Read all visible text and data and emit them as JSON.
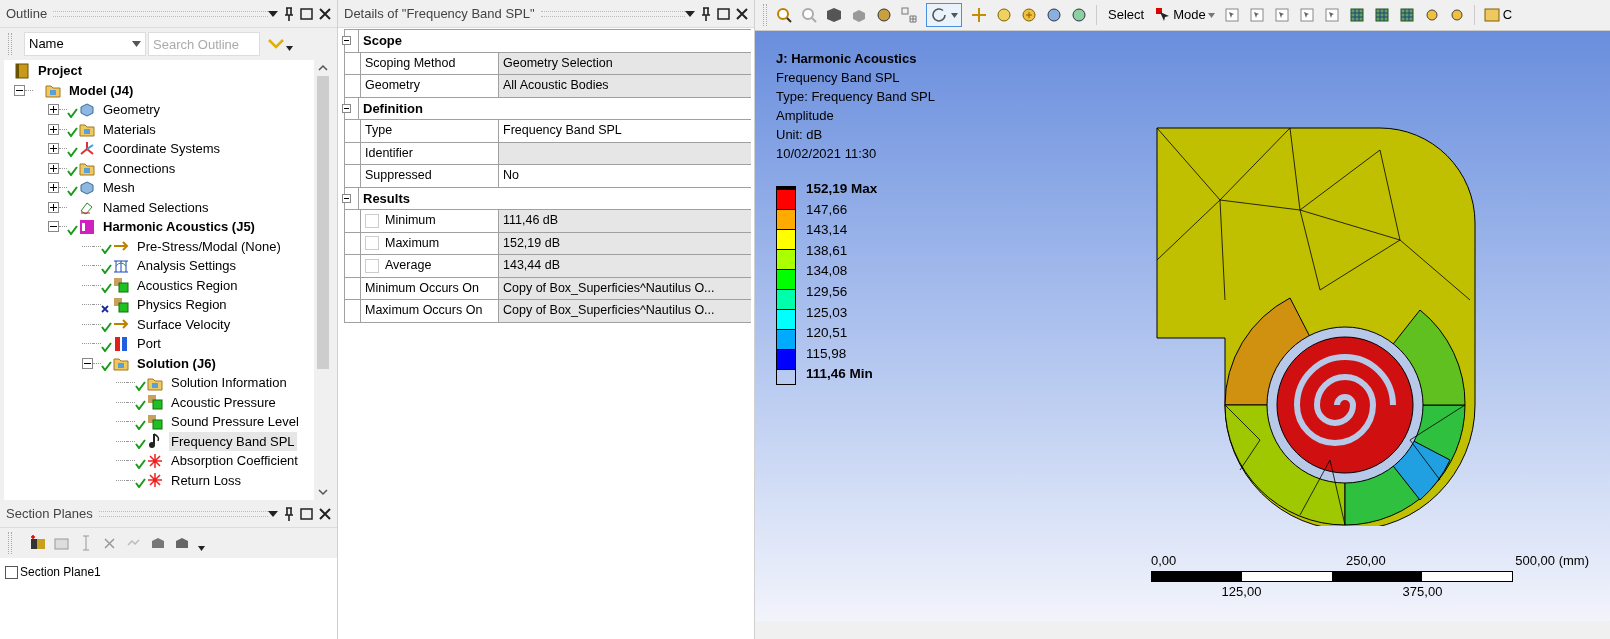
{
  "outline": {
    "title": "Outline",
    "column_dropdown": "Name",
    "search": {
      "placeholder": "Search Outline"
    },
    "tree": [
      {
        "label": "Project",
        "bold": true,
        "selected": false,
        "children": [
          {
            "label": "Model (J4)",
            "bold": true,
            "expanded": true,
            "selected": false,
            "children": [
              {
                "label": "Geometry",
                "valid": true,
                "expanded": false,
                "selected": false
              },
              {
                "label": "Materials",
                "valid": true,
                "expanded": false,
                "selected": false
              },
              {
                "label": "Coordinate Systems",
                "valid": true,
                "expanded": false,
                "selected": false
              },
              {
                "label": "Connections",
                "valid": true,
                "expanded": false,
                "selected": false
              },
              {
                "label": "Mesh",
                "valid": true,
                "expanded": false,
                "selected": false
              },
              {
                "label": "Named Selections",
                "expanded": false,
                "selected": false
              },
              {
                "label": "Harmonic Acoustics (J5)",
                "bold": true,
                "valid": true,
                "expanded": true,
                "selected": false,
                "children": [
                  {
                    "label": "Pre-Stress/Modal (None)",
                    "valid": true,
                    "selected": false
                  },
                  {
                    "label": "Analysis Settings",
                    "valid": true,
                    "selected": false
                  },
                  {
                    "label": "Acoustics Region",
                    "valid": true,
                    "selected": false
                  },
                  {
                    "label": "Physics Region",
                    "valid": false,
                    "selected": false
                  },
                  {
                    "label": "Surface Velocity",
                    "valid": true,
                    "selected": false
                  },
                  {
                    "label": "Port",
                    "valid": true,
                    "selected": false
                  },
                  {
                    "label": "Solution (J6)",
                    "bold": true,
                    "valid": true,
                    "expanded": true,
                    "selected": false,
                    "children": [
                      {
                        "label": "Solution Information",
                        "valid": true,
                        "selected": false
                      },
                      {
                        "label": "Acoustic Pressure",
                        "valid": true,
                        "selected": false
                      },
                      {
                        "label": "Sound Pressure Level",
                        "valid": true,
                        "selected": false
                      },
                      {
                        "label": "Frequency Band SPL",
                        "valid": true,
                        "selected": true
                      },
                      {
                        "label": "Absorption Coefficient",
                        "valid": true,
                        "selected": false
                      },
                      {
                        "label": "Return Loss",
                        "valid": true,
                        "selected": false
                      }
                    ]
                  }
                ]
              }
            ]
          }
        ]
      }
    ]
  },
  "section_planes": {
    "title": "Section Planes",
    "items": [
      {
        "label": "Section Plane1",
        "checked": false
      }
    ]
  },
  "details": {
    "title": "Details of \"Frequency Band SPL\"",
    "sections": [
      {
        "title": "Scope",
        "expanded": true,
        "rows": [
          {
            "kind": "plain",
            "label": "Scoping Method",
            "value": "Geometry Selection",
            "editable": false
          },
          {
            "kind": "plain",
            "label": "Geometry",
            "value": "All Acoustic Bodies",
            "editable": false
          }
        ]
      },
      {
        "title": "Definition",
        "expanded": true,
        "rows": [
          {
            "kind": "plain",
            "label": "Type",
            "value": "Frequency Band SPL",
            "editable": true
          },
          {
            "kind": "plain",
            "label": "Identifier",
            "value": "",
            "editable": false
          },
          {
            "kind": "plain",
            "label": "Suppressed",
            "value": "No",
            "editable": true
          }
        ]
      },
      {
        "title": "Results",
        "expanded": true,
        "rows": [
          {
            "kind": "checkbox",
            "checked": false,
            "label": "Minimum",
            "value": "111,46 dB",
            "editable": false
          },
          {
            "kind": "checkbox",
            "checked": false,
            "label": "Maximum",
            "value": "152,19 dB",
            "editable": false
          },
          {
            "kind": "checkbox",
            "checked": false,
            "label": "Average",
            "value": "143,44 dB",
            "editable": false
          },
          {
            "kind": "plain",
            "label": "Minimum Occurs On",
            "value": "Copy of Box_Superficies^Nautilus O...",
            "editable": false
          },
          {
            "kind": "plain",
            "label": "Maximum Occurs On",
            "value": "Copy of Box_Superficies^Nautilus O...",
            "editable": false
          }
        ]
      }
    ]
  },
  "viewport": {
    "toolbar": {
      "select_label": "Select",
      "mode_label": "Mode",
      "cut_label": "C"
    },
    "annotation": {
      "title": "J: Harmonic Acoustics",
      "lines": [
        "Frequency Band SPL",
        "Type: Frequency Band SPL",
        "Amplitude",
        "Unit: dB",
        "10/02/2021 11:30"
      ]
    },
    "legend": {
      "bands": [
        {
          "color": "#ff0000"
        },
        {
          "color": "#ffaa00"
        },
        {
          "color": "#ffff00"
        },
        {
          "color": "#aaff00"
        },
        {
          "color": "#00ff00"
        },
        {
          "color": "#00ffaa"
        },
        {
          "color": "#00ffff"
        },
        {
          "color": "#00aaff"
        },
        {
          "color": "#0000ff"
        }
      ],
      "labels": [
        {
          "text": "152,19 Max",
          "kind": "extreme"
        },
        {
          "text": "147,66",
          "kind": "tick"
        },
        {
          "text": "143,14",
          "kind": "tick"
        },
        {
          "text": "138,61",
          "kind": "tick"
        },
        {
          "text": "134,08",
          "kind": "tick"
        },
        {
          "text": "129,56",
          "kind": "tick"
        },
        {
          "text": "125,03",
          "kind": "tick"
        },
        {
          "text": "120,51",
          "kind": "tick"
        },
        {
          "text": "115,98",
          "kind": "tick"
        },
        {
          "text": "111,46 Min",
          "kind": "extreme"
        }
      ]
    },
    "scale_bar": {
      "top_labels": [
        "0,00",
        "250,00",
        "500,00 (mm)"
      ],
      "bottom_labels": [
        "125,00",
        "375,00"
      ]
    }
  }
}
